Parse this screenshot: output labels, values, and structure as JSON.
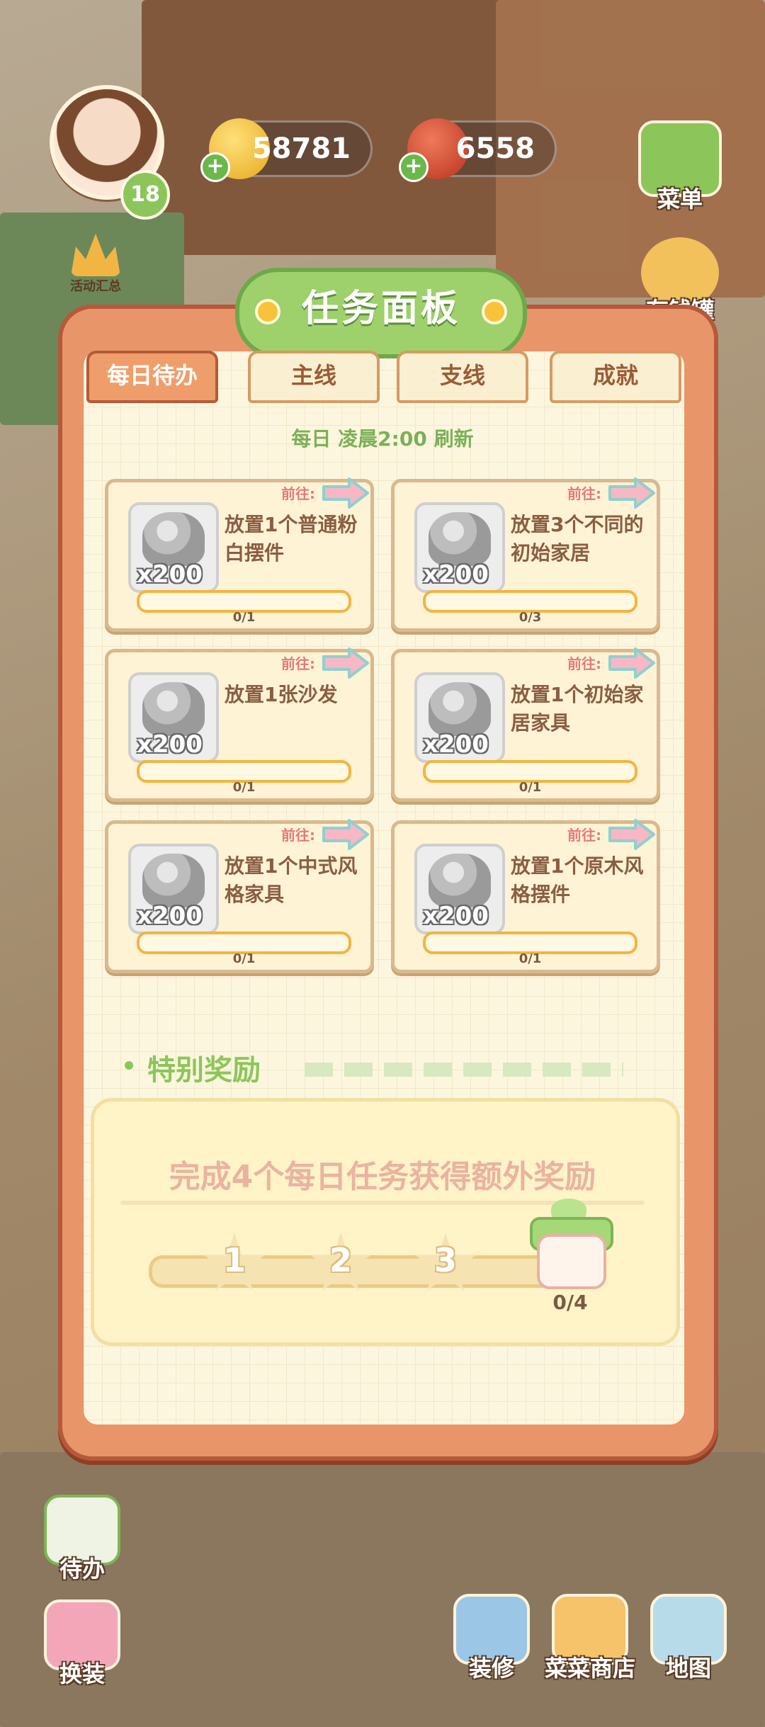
{
  "hud": {
    "level": "18",
    "event_label": "活动汇总",
    "coins": "58781",
    "tomatoes": "6558",
    "menu_label": "菜单",
    "piggy_label": "存钱罐"
  },
  "panel": {
    "title": "任务面板",
    "tabs": [
      {
        "label": "每日待办",
        "active": true
      },
      {
        "label": "主线",
        "active": false
      },
      {
        "label": "支线",
        "active": false
      },
      {
        "label": "成就",
        "active": false
      }
    ],
    "refresh_text": "每日 凌晨2:00 刷新",
    "go_label": "前往:",
    "tasks": [
      {
        "qty": "x200",
        "desc": "放置1个普通粉白摆件",
        "progress": "0/1",
        "fraction": 0
      },
      {
        "qty": "x200",
        "desc": "放置3个不同的初始家居",
        "progress": "0/3",
        "fraction": 0
      },
      {
        "qty": "x200",
        "desc": "放置1张沙发",
        "progress": "0/1",
        "fraction": 0
      },
      {
        "qty": "x200",
        "desc": "放置1个初始家居家具",
        "progress": "0/1",
        "fraction": 0
      },
      {
        "qty": "x200",
        "desc": "放置1个中式风格家具",
        "progress": "0/1",
        "fraction": 0
      },
      {
        "qty": "x200",
        "desc": "放置1个原木风格摆件",
        "progress": "0/1",
        "fraction": 0
      }
    ],
    "special_title": "特别奖励",
    "reward_text": "完成4个每日任务获得额外奖励",
    "milestones": [
      "1",
      "2",
      "3"
    ],
    "reward_progress": "0/4"
  },
  "bottom": {
    "todo_label": "待办",
    "dress_label": "换装",
    "decor_label": "装修",
    "shop_label": "菜菜商店",
    "map_label": "地图"
  },
  "colors": {
    "panel_orange": "#e9956a",
    "tab_active": "#ef9e6b",
    "title_green": "#9ed06c",
    "bar_yellow": "#f2b53e"
  }
}
